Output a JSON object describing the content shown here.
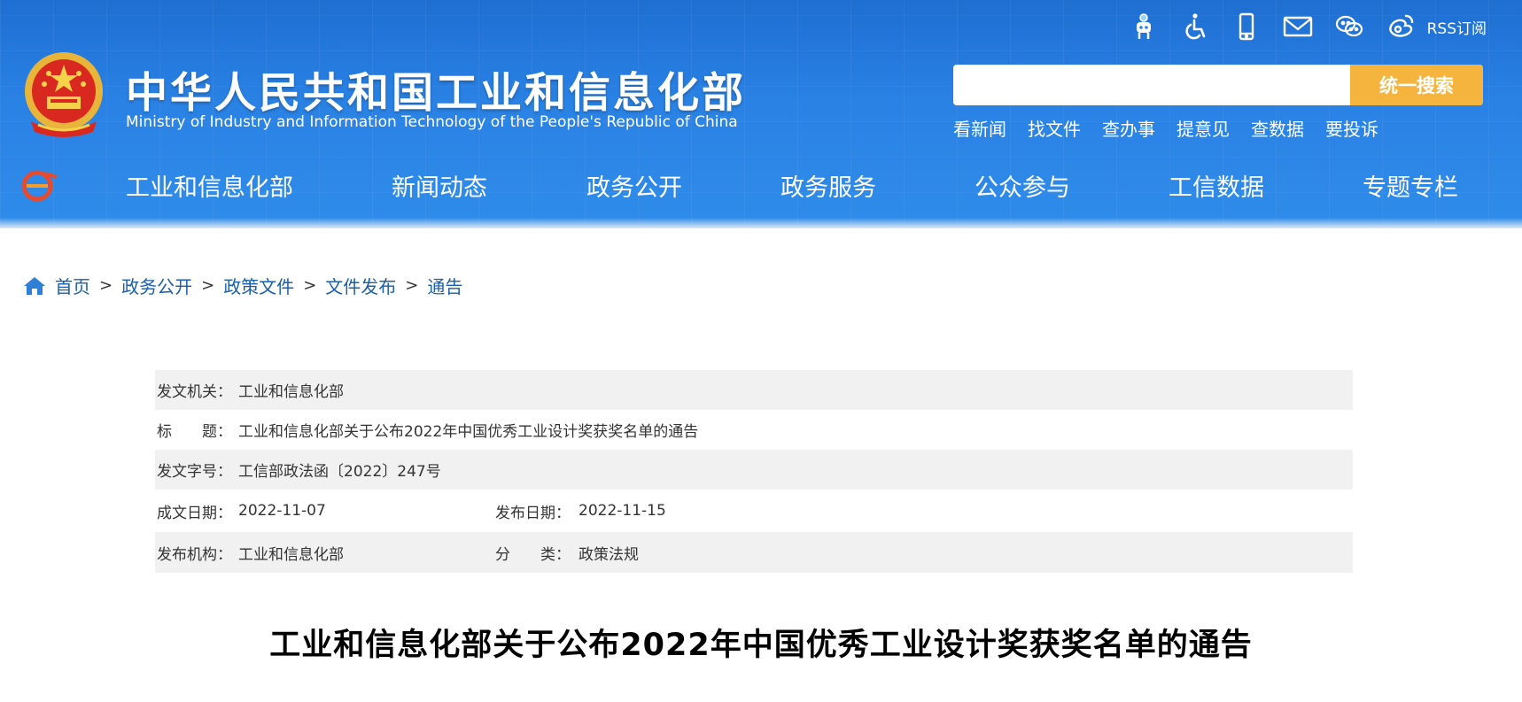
{
  "header": {
    "title_cn": "中华人民共和国工业和信息化部",
    "title_en": "Ministry of Industry and Information Technology of the People's Republic of China",
    "top_icons": [
      "robot-icon",
      "accessibility-icon",
      "mobile-icon",
      "mail-icon",
      "wechat-icon",
      "weibo-icon"
    ],
    "rss_label": "RSS订阅",
    "search": {
      "placeholder": "",
      "button_label": "统一搜索"
    },
    "quick_links": [
      "看新闻",
      "找文件",
      "查办事",
      "提意见",
      "查数据",
      "要投诉"
    ]
  },
  "nav": {
    "items": [
      "工业和信息化部",
      "新闻动态",
      "政务公开",
      "政务服务",
      "公众参与",
      "工信数据",
      "专题专栏"
    ]
  },
  "breadcrumb": {
    "items": [
      "首页",
      "政务公开",
      "政策文件",
      "文件发布",
      "通告"
    ],
    "separator": ">"
  },
  "meta": {
    "issuer_label": "发文机关：",
    "issuer": "工业和信息化部",
    "title_label": "标　　题：",
    "title": "工业和信息化部关于公布2022年中国优秀工业设计奖获奖名单的通告",
    "doc_no_label": "发文字号：",
    "doc_no": "工信部政法函〔2022〕247号",
    "created_label": "成文日期：",
    "created": "2022-11-07",
    "published_label": "发布日期：",
    "published": "2022-11-15",
    "agency_label": "发布机构：",
    "agency": "工业和信息化部",
    "category_label": "分　　类：",
    "category": "政策法规"
  },
  "article": {
    "title": "工业和信息化部关于公布2022年中国优秀工业设计奖获奖名单的通告"
  },
  "colors": {
    "header_blue": "#2a82e4",
    "search_button": "#f5b43d",
    "link_blue": "#1a5fa8",
    "meta_shade": "#f1f1f1"
  }
}
